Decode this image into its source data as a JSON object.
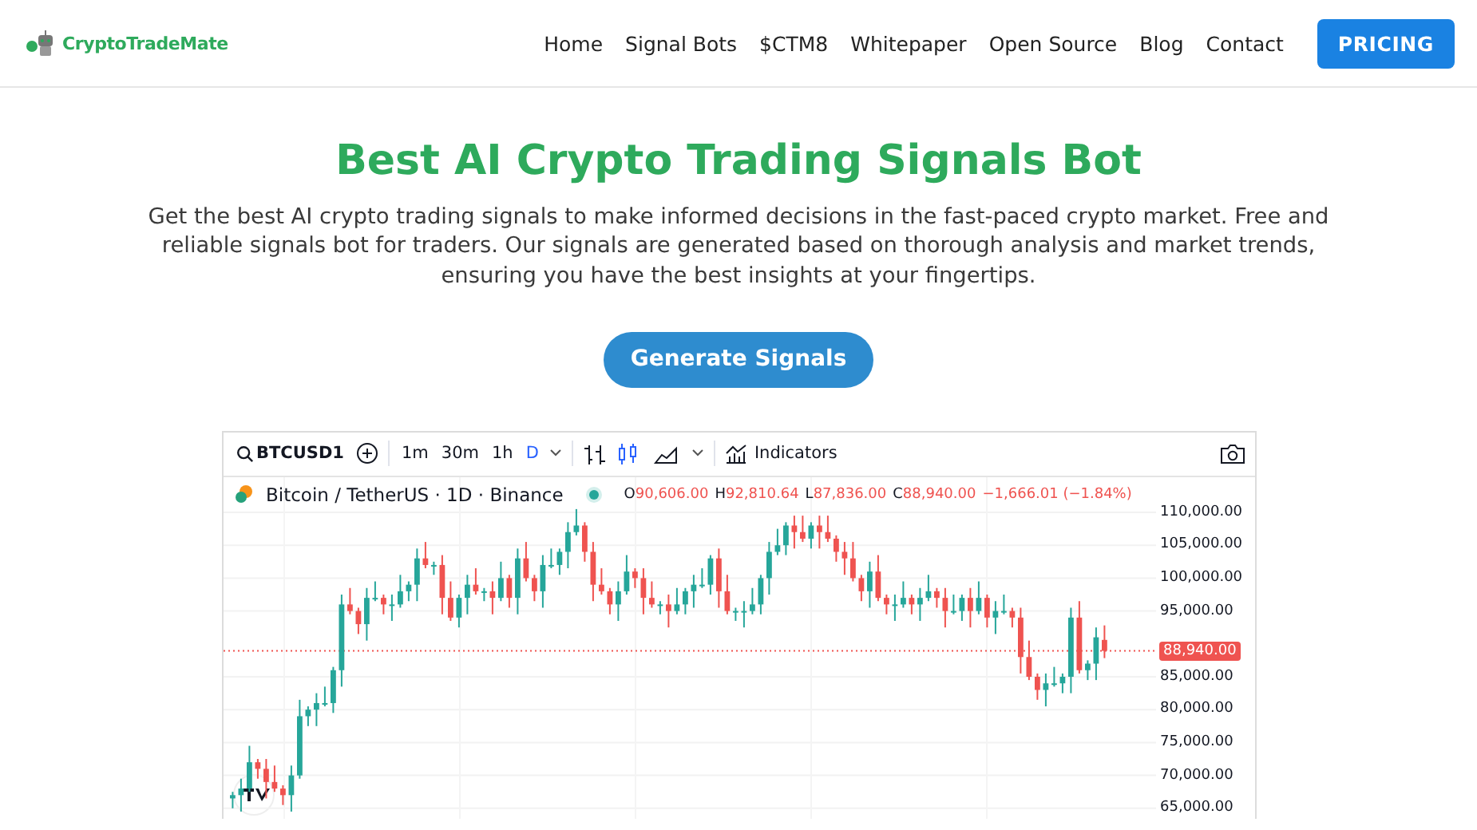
{
  "brand": {
    "name": "CryptoTradeMate"
  },
  "nav": {
    "links": [
      "Home",
      "Signal Bots",
      "$CTM8",
      "Whitepaper",
      "Open Source",
      "Blog",
      "Contact"
    ],
    "cta": "PRICING"
  },
  "hero": {
    "title": "Best AI Crypto Trading Signals Bot",
    "text": "Get the best AI crypto trading signals to make informed decisions in the fast-paced crypto market. Free and reliable signals bot for traders. Our signals are generated based on thorough analysis and market trends, ensuring you have the best insights at your fingertips.",
    "button": "Generate Signals"
  },
  "chart_widget": {
    "symbol": "BTCUSD1",
    "intervals": [
      {
        "label": "1m",
        "selected": false
      },
      {
        "label": "30m",
        "selected": false
      },
      {
        "label": "1h",
        "selected": false
      },
      {
        "label": "D",
        "selected": true
      }
    ],
    "chart_styles": [
      {
        "kind": "bars",
        "selected": false
      },
      {
        "kind": "candles",
        "selected": true
      },
      {
        "kind": "area",
        "selected": false
      }
    ],
    "indicators": "Indicators",
    "legend": {
      "title": "Bitcoin / TetherUS · 1D · Binance",
      "ohlc": [
        {
          "label": "O",
          "value": "90,606.00"
        },
        {
          "label": "H",
          "value": "92,810.64"
        },
        {
          "label": "L",
          "value": "87,836.00"
        },
        {
          "label": "C",
          "value": "88,940.00"
        }
      ],
      "change": "−1,666.01 (−1.84%)"
    },
    "chart_data": {
      "type": "candlestick",
      "grid": true,
      "ylim": [
        65000,
        110000
      ],
      "ref_lines": [
        {
          "axis": "y",
          "value": 88940,
          "label": "88,940.00",
          "color": "#ef5350"
        }
      ],
      "ohlc": [
        [
          66500,
          67500,
          65000,
          67000
        ],
        [
          67000,
          69500,
          64500,
          68000
        ],
        [
          68000,
          74500,
          67500,
          72000
        ],
        [
          72000,
          72500,
          69500,
          71000
        ],
        [
          71000,
          72500,
          66500,
          69000
        ],
        [
          69000,
          71500,
          67500,
          68000
        ],
        [
          68000,
          68500,
          65500,
          67000
        ],
        [
          67000,
          71500,
          64500,
          70000
        ],
        [
          70000,
          81500,
          69500,
          79000
        ],
        [
          79000,
          80500,
          77500,
          80000
        ],
        [
          80000,
          82500,
          77500,
          81000
        ],
        [
          81000,
          83500,
          80500,
          81000
        ],
        [
          81000,
          86500,
          79500,
          86000
        ],
        [
          86000,
          97500,
          83500,
          96000
        ],
        [
          96000,
          98500,
          94500,
          95000
        ],
        [
          95000,
          95500,
          91500,
          93000
        ],
        [
          93000,
          98500,
          90500,
          97000
        ],
        [
          97000,
          99500,
          96500,
          97000
        ],
        [
          97000,
          97500,
          94500,
          96000
        ],
        [
          96000,
          97500,
          93500,
          96000
        ],
        [
          96000,
          100500,
          95500,
          98000
        ],
        [
          98000,
          99500,
          96500,
          99000
        ],
        [
          99000,
          104500,
          96500,
          103000
        ],
        [
          103000,
          105500,
          101500,
          102000
        ],
        [
          102000,
          102500,
          100500,
          102000
        ],
        [
          102000,
          103500,
          94500,
          97000
        ],
        [
          97000,
          99500,
          93500,
          94000
        ],
        [
          94000,
          97500,
          92500,
          97000
        ],
        [
          97000,
          100500,
          94500,
          99000
        ],
        [
          99000,
          101500,
          97500,
          98000
        ],
        [
          98000,
          98500,
          96500,
          98000
        ],
        [
          98000,
          99500,
          94500,
          97000
        ],
        [
          97000,
          102500,
          96500,
          100000
        ],
        [
          100000,
          100500,
          95500,
          97000
        ],
        [
          97000,
          104500,
          94500,
          103000
        ],
        [
          103000,
          105500,
          99500,
          100000
        ],
        [
          100000,
          100500,
          96500,
          98000
        ],
        [
          98000,
          103500,
          95500,
          102000
        ],
        [
          102000,
          104500,
          101500,
          102000
        ],
        [
          102000,
          104500,
          100500,
          104000
        ],
        [
          104000,
          108500,
          101500,
          107000
        ],
        [
          107000,
          110500,
          106500,
          108000
        ],
        [
          108000,
          108500,
          102500,
          104000
        ],
        [
          104000,
          105500,
          96500,
          99000
        ],
        [
          99000,
          101500,
          97500,
          98000
        ],
        [
          98000,
          98500,
          94500,
          96000
        ],
        [
          96000,
          99500,
          93500,
          98000
        ],
        [
          98000,
          103500,
          97500,
          101000
        ],
        [
          101000,
          101500,
          98500,
          100000
        ],
        [
          100000,
          101500,
          94500,
          97000
        ],
        [
          97000,
          99500,
          95500,
          96000
        ],
        [
          96000,
          96500,
          94500,
          96000
        ],
        [
          96000,
          97500,
          92500,
          95000
        ],
        [
          95000,
          98500,
          94500,
          96000
        ],
        [
          96000,
          98500,
          94500,
          98000
        ],
        [
          98000,
          100500,
          95500,
          99000
        ],
        [
          99000,
          101500,
          98500,
          99000
        ],
        [
          99000,
          103500,
          97500,
          103000
        ],
        [
          103000,
          104500,
          95500,
          98000
        ],
        [
          98000,
          100500,
          94500,
          95000
        ],
        [
          95000,
          95500,
          93500,
          95000
        ],
        [
          95000,
          96500,
          92500,
          95000
        ],
        [
          95000,
          98500,
          94500,
          96000
        ],
        [
          96000,
          100500,
          94500,
          100000
        ],
        [
          100000,
          105500,
          97500,
          104000
        ],
        [
          104000,
          107500,
          103500,
          105000
        ],
        [
          105000,
          108500,
          103500,
          108000
        ],
        [
          108000,
          109500,
          104500,
          107000
        ],
        [
          107000,
          109500,
          105500,
          106000
        ],
        [
          106000,
          108500,
          104500,
          108000
        ],
        [
          108000,
          109500,
          104500,
          107000
        ],
        [
          107000,
          109500,
          105500,
          106000
        ],
        [
          106000,
          106500,
          102500,
          104000
        ],
        [
          104000,
          105500,
          100500,
          103000
        ],
        [
          103000,
          105500,
          99500,
          100000
        ],
        [
          100000,
          100500,
          96500,
          98000
        ],
        [
          98000,
          102500,
          95500,
          101000
        ],
        [
          101000,
          103500,
          96500,
          97000
        ],
        [
          97000,
          97500,
          94500,
          96000
        ],
        [
          96000,
          97500,
          93500,
          96000
        ],
        [
          96000,
          99500,
          95500,
          97000
        ],
        [
          97000,
          97500,
          94500,
          96000
        ],
        [
          96000,
          98500,
          93500,
          97000
        ],
        [
          97000,
          100500,
          96500,
          98000
        ],
        [
          98000,
          98500,
          95500,
          97000
        ],
        [
          97000,
          98500,
          92500,
          95000
        ],
        [
          95000,
          97500,
          94500,
          95000
        ],
        [
          95000,
          97500,
          93500,
          97000
        ],
        [
          97000,
          98500,
          92500,
          95000
        ],
        [
          95000,
          99500,
          94500,
          97000
        ],
        [
          97000,
          97500,
          92500,
          94000
        ],
        [
          94000,
          96500,
          91500,
          95000
        ],
        [
          95000,
          97500,
          94500,
          95000
        ],
        [
          95000,
          95500,
          92500,
          94000
        ],
        [
          94000,
          95500,
          85500,
          88000
        ],
        [
          88000,
          90500,
          84500,
          85000
        ],
        [
          85000,
          85500,
          81500,
          83000
        ],
        [
          83000,
          85500,
          80500,
          84000
        ],
        [
          84000,
          86500,
          83500,
          84000
        ],
        [
          84000,
          85500,
          82500,
          85000
        ],
        [
          85000,
          95500,
          82500,
          94000
        ],
        [
          94000,
          96500,
          85500,
          86000
        ],
        [
          86000,
          87500,
          84500,
          87000
        ],
        [
          87000,
          92500,
          84500,
          91000
        ],
        [
          90606,
          92810.64,
          87836,
          88940
        ]
      ],
      "yticks": [
        {
          "value": 110000,
          "label": "110,000.00"
        },
        {
          "value": 105000,
          "label": "105,000.00"
        },
        {
          "value": 100000,
          "label": "100,000.00"
        },
        {
          "value": 95000,
          "label": "95,000.00"
        },
        {
          "value": 85000,
          "label": "85,000.00"
        },
        {
          "value": 80000,
          "label": "80,000.00"
        },
        {
          "value": 75000,
          "label": "75,000.00"
        },
        {
          "value": 70000,
          "label": "70,000.00"
        },
        {
          "value": 65000,
          "label": "65,000.00"
        }
      ]
    }
  }
}
